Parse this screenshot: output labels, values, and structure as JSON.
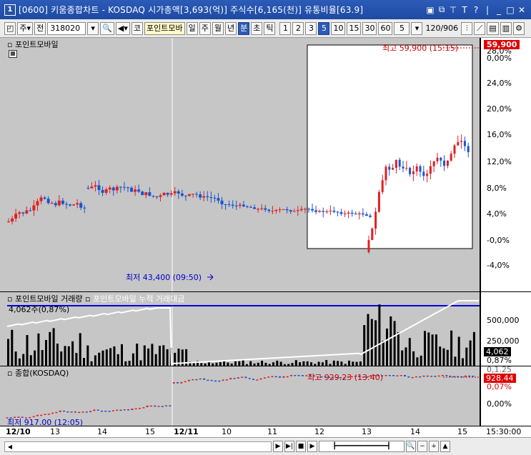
{
  "window": {
    "app_number": "1",
    "title": "[0600] 키움종합차트 - KOSDAQ 시가총액[3,693(억)] 주식수[6,165(천)] 유통비율[63.9]",
    "controls": [
      "▣",
      "⧉",
      "ᄑ",
      "T",
      "?",
      "|",
      "_",
      "□",
      "✕"
    ]
  },
  "toolbar": {
    "period_select": "주",
    "prev_label": "전",
    "code_value": "318020",
    "market_label": "코",
    "stock_name": "포인트모바",
    "period_buttons": [
      "일",
      "주",
      "월",
      "년",
      "분",
      "초",
      "틱"
    ],
    "active_period": "분",
    "interval_buttons": [
      "1",
      "2",
      "3",
      "5",
      "10",
      "15",
      "30",
      "60"
    ],
    "active_interval": "5",
    "interval_select": "5",
    "count_display": "120/906"
  },
  "price_pane": {
    "label": "포인트모바일",
    "low_annotation": "최저 43,400 (09:50)",
    "high_annotation": "최고 59,900 (15:15)",
    "current_price_badge": "59,900",
    "axis_ticks": [
      "28,0%",
      "0,00%",
      "24,0%",
      "20,0%",
      "16,0%",
      "12,0%",
      "8,0%",
      "4,0%",
      "-0,0%",
      "-4,0%"
    ],
    "axis_values": [
      28,
      24,
      20,
      16,
      12,
      8,
      4,
      0,
      -4
    ]
  },
  "volume_pane": {
    "label": "포인트모바일 거래량",
    "label2": "포인트모바일 누적 거래대금",
    "sub_label": "4,062주(0,87%)",
    "axis_ticks": [
      "500,000",
      "250,000"
    ],
    "current_badge": "4,062",
    "current_pct": "0,87%"
  },
  "index_pane": {
    "label": "종합(KOSDAQ)",
    "low_annotation": "최저 917.00 (12:05)",
    "high_annotation": "최고 929.23 (13:40)",
    "current_badge": "928.44",
    "current_pct": "0,07%",
    "axis_ticks": [
      "0,00%"
    ],
    "axis_top_partial": "0,1.25"
  },
  "time_axis": {
    "labels": [
      "12/10",
      "13",
      "14",
      "15",
      "12/11",
      "10",
      "11",
      "12",
      "13",
      "14",
      "15"
    ],
    "right_label": "15:30:00"
  },
  "chart_data": {
    "type": "candlestick",
    "title": "",
    "days": [
      "12/10",
      "12/11"
    ],
    "price_range_pct": [
      -6,
      29
    ],
    "note_values": {
      "low": 43400,
      "high": 59900,
      "last": 59900
    }
  }
}
